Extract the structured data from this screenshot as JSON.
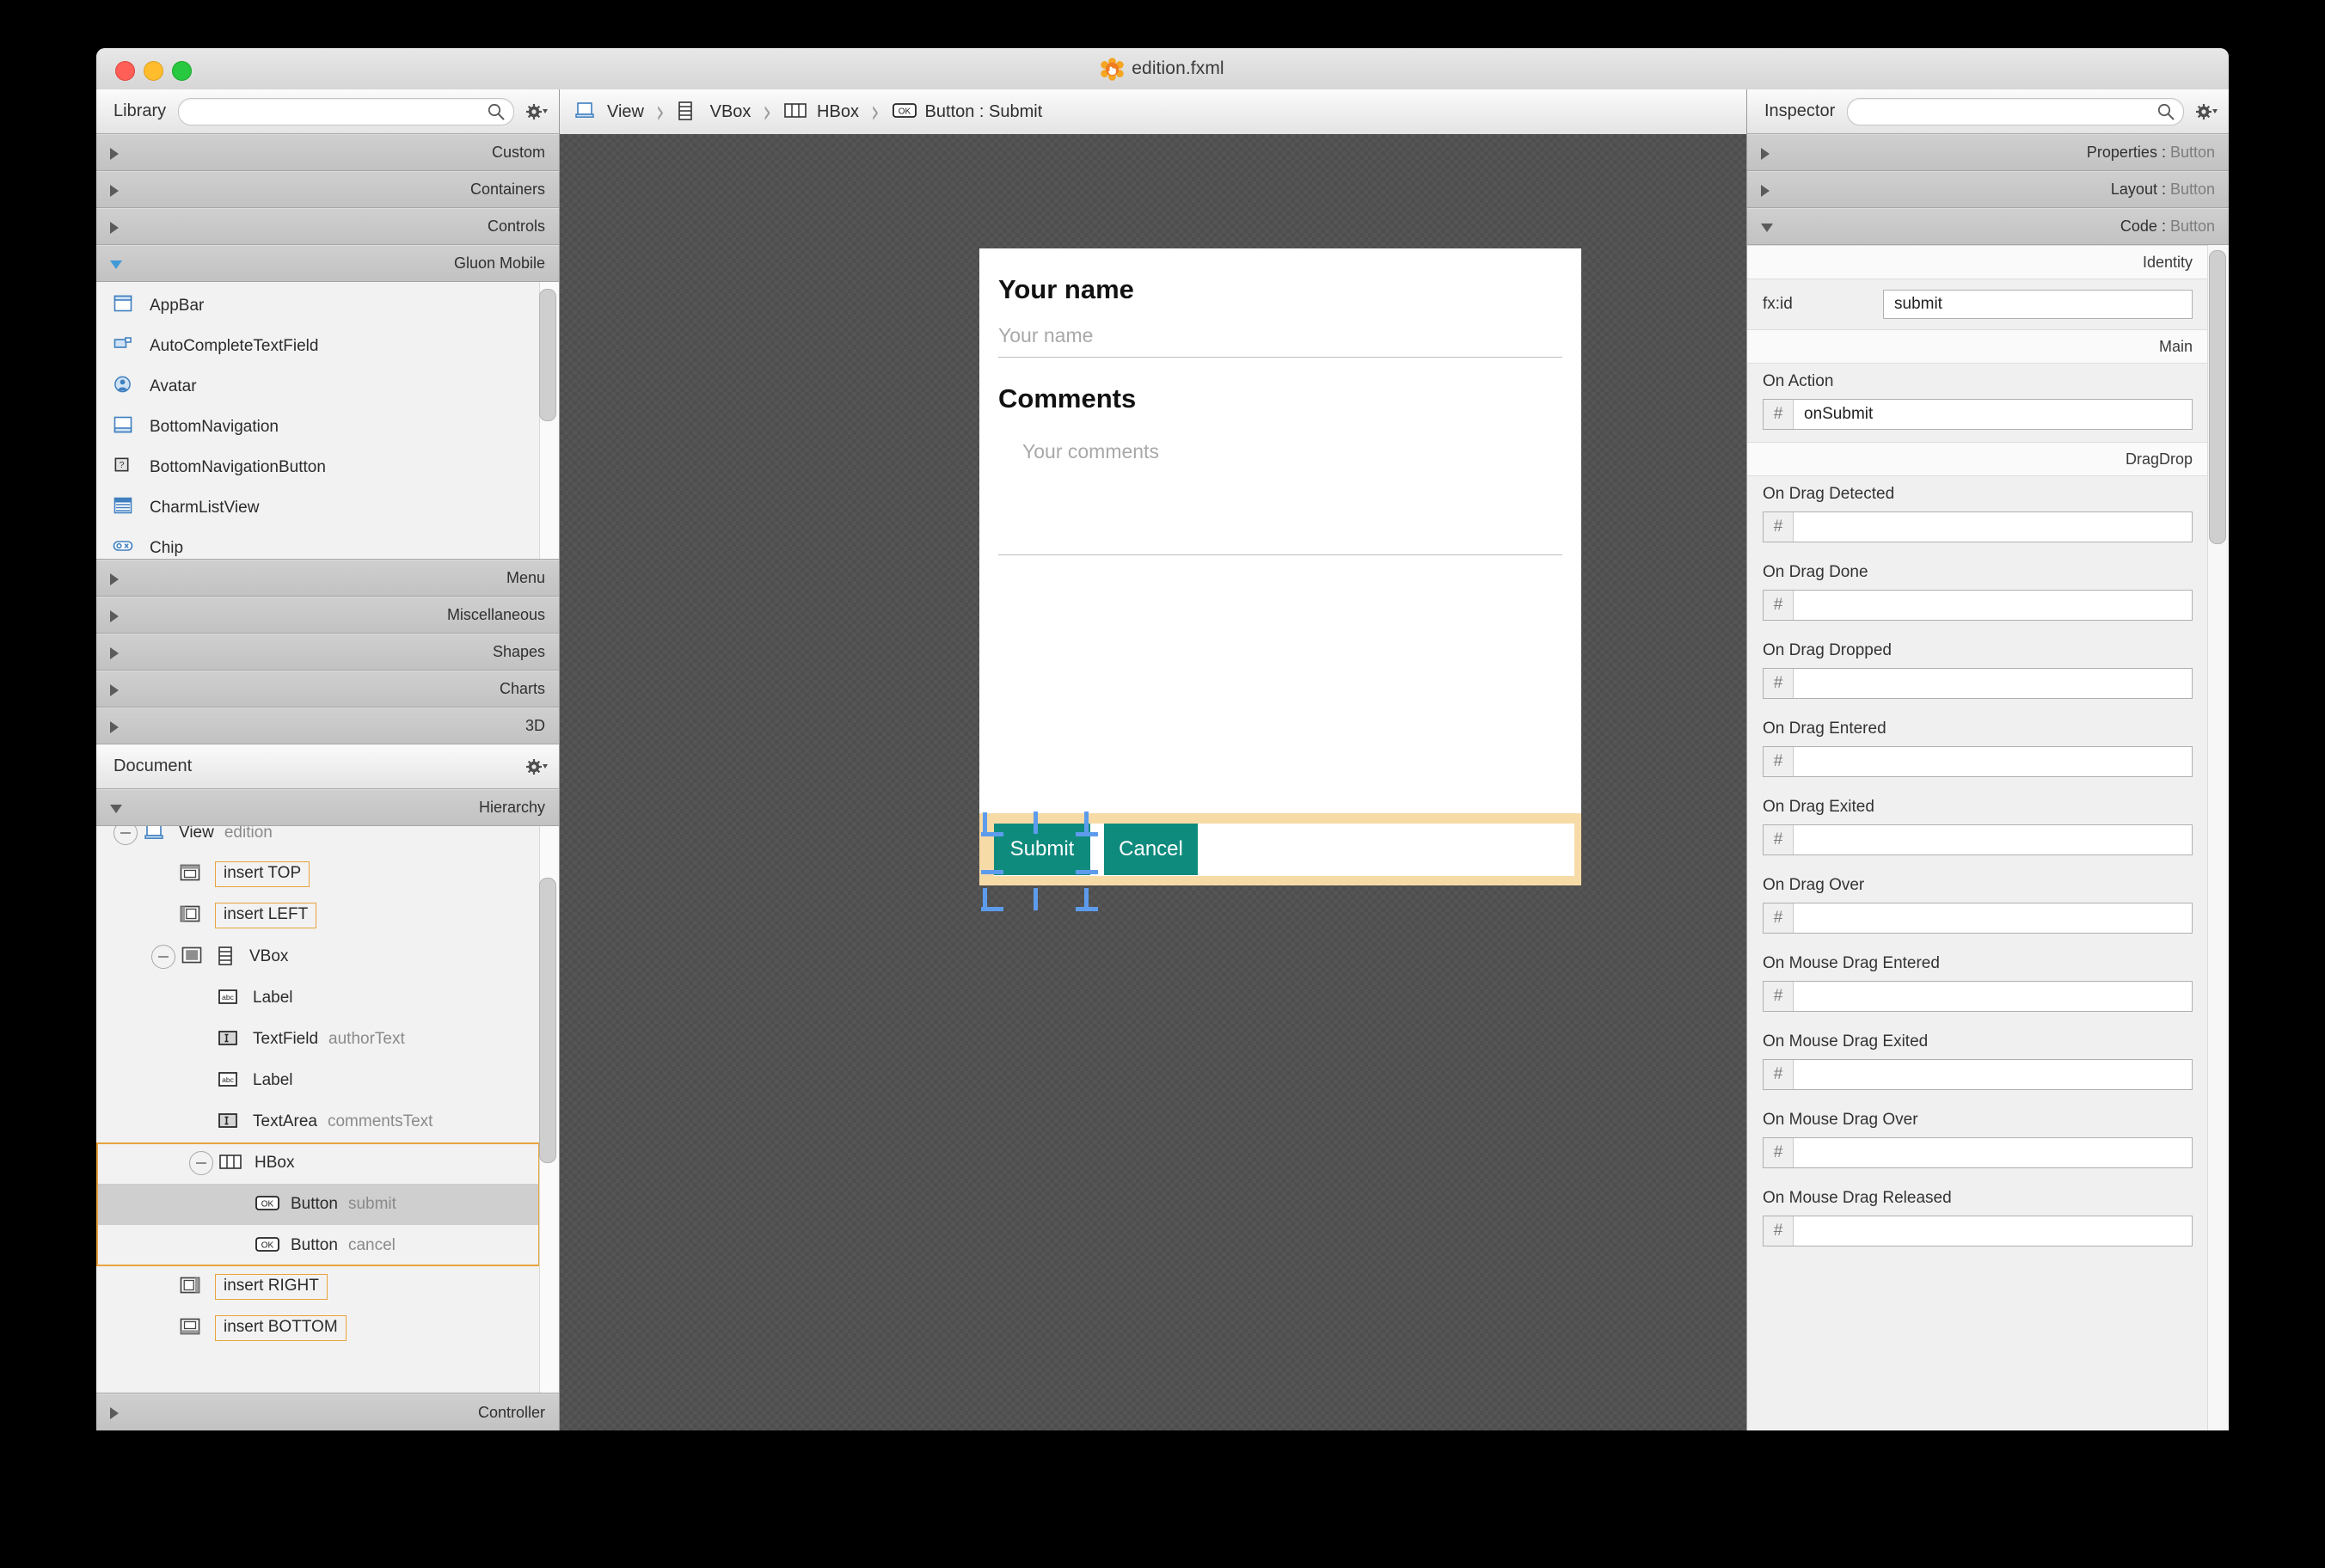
{
  "window": {
    "title": "edition.fxml",
    "app_icon": "scenebuilder-icon"
  },
  "library": {
    "panel_title": "Library",
    "search_placeholder": "",
    "search_value": "",
    "sections_top": [
      {
        "label": "Custom",
        "expanded": false
      },
      {
        "label": "Containers",
        "expanded": false
      },
      {
        "label": "Controls",
        "expanded": false
      },
      {
        "label": "Gluon Mobile",
        "expanded": true
      }
    ],
    "items": [
      {
        "label": "AppBar",
        "icon": "appbar-icon"
      },
      {
        "label": "AutoCompleteTextField",
        "icon": "autocomplete-textfield-icon"
      },
      {
        "label": "Avatar",
        "icon": "avatar-icon"
      },
      {
        "label": "BottomNavigation",
        "icon": "bottomnavigation-icon"
      },
      {
        "label": "BottomNavigationButton",
        "icon": "bottomnavigationbutton-icon"
      },
      {
        "label": "CharmListView",
        "icon": "charmlistview-icon"
      },
      {
        "label": "Chip",
        "icon": "chip-icon"
      }
    ],
    "sections_bottom": [
      {
        "label": "Menu",
        "expanded": false
      },
      {
        "label": "Miscellaneous",
        "expanded": false
      },
      {
        "label": "Shapes",
        "expanded": false
      },
      {
        "label": "Charts",
        "expanded": false
      },
      {
        "label": "3D",
        "expanded": false
      }
    ]
  },
  "document": {
    "panel_title": "Document",
    "hierarchy_label": "Hierarchy",
    "hierarchy_expanded": true,
    "controller_label": "Controller",
    "controller_expanded": false,
    "tree": [
      {
        "indent": 0,
        "expander": "minus",
        "icon": "view-icon",
        "name": "View",
        "fxid": "edition",
        "pill": false,
        "selected": false
      },
      {
        "indent": 1,
        "expander": "none",
        "icon": "insert-top-icon",
        "name": "insert TOP",
        "fxid": "",
        "pill": true,
        "selected": false
      },
      {
        "indent": 1,
        "expander": "none",
        "icon": "insert-left-icon",
        "name": "insert LEFT",
        "fxid": "",
        "pill": true,
        "selected": false
      },
      {
        "indent": 1,
        "expander": "minus",
        "icon": "center-icon",
        "icon2": "vbox-icon",
        "name": "VBox",
        "fxid": "",
        "pill": false,
        "selected": false
      },
      {
        "indent": 2,
        "expander": "none",
        "icon": "label-icon",
        "name": "Label",
        "fxid": "",
        "pill": false,
        "selected": false
      },
      {
        "indent": 2,
        "expander": "none",
        "icon": "textfield-icon",
        "name": "TextField",
        "fxid": "authorText",
        "pill": false,
        "selected": false
      },
      {
        "indent": 2,
        "expander": "none",
        "icon": "label-icon",
        "name": "Label",
        "fxid": "",
        "pill": false,
        "selected": false
      },
      {
        "indent": 2,
        "expander": "none",
        "icon": "textarea-icon",
        "name": "TextArea",
        "fxid": "commentsText",
        "pill": false,
        "selected": false
      },
      {
        "indent": 2,
        "expander": "minus",
        "icon": "hbox-icon",
        "name": "HBox",
        "fxid": "",
        "pill": false,
        "selected": false
      },
      {
        "indent": 3,
        "expander": "none",
        "icon": "button-icon",
        "name": "Button",
        "fxid": "submit",
        "pill": false,
        "selected": true
      },
      {
        "indent": 3,
        "expander": "none",
        "icon": "button-icon",
        "name": "Button",
        "fxid": "cancel",
        "pill": false,
        "selected": false
      },
      {
        "indent": 1,
        "expander": "none",
        "icon": "insert-right-icon",
        "name": "insert RIGHT",
        "fxid": "",
        "pill": true,
        "selected": false
      },
      {
        "indent": 1,
        "expander": "none",
        "icon": "insert-bottom-icon",
        "name": "insert BOTTOM",
        "fxid": "",
        "pill": true,
        "selected": false
      }
    ]
  },
  "breadcrumb": [
    {
      "label": "View",
      "icon": "view-icon"
    },
    {
      "label": "VBox",
      "icon": "vbox-icon"
    },
    {
      "label": "HBox",
      "icon": "hbox-icon"
    },
    {
      "label": "Button : Submit",
      "icon": "button-icon"
    }
  ],
  "canvas": {
    "name_heading": "Your name",
    "name_placeholder": "Your name",
    "comments_heading": "Comments",
    "comments_placeholder": "Your comments",
    "submit_label": "Submit",
    "cancel_label": "Cancel",
    "selection_color": "#5d9cec",
    "hbox_highlight_color": "#f7dba7",
    "button_color": "#0f8b7e"
  },
  "inspector": {
    "panel_title": "Inspector",
    "search_placeholder": "",
    "search_value": "",
    "sections": [
      {
        "label": "Properties",
        "target": "Button",
        "expanded": false
      },
      {
        "label": "Layout",
        "target": "Button",
        "expanded": false
      },
      {
        "label": "Code",
        "target": "Button",
        "expanded": true
      }
    ],
    "categories": {
      "identity": "Identity",
      "main": "Main",
      "dragdrop": "DragDrop"
    },
    "fxid_label": "fx:id",
    "fxid_value": "submit",
    "hash_prefix": "#",
    "events": [
      {
        "label": "On Action",
        "value": "onSubmit",
        "group": "main"
      },
      {
        "label": "On Drag Detected",
        "value": "",
        "group": "dragdrop"
      },
      {
        "label": "On Drag Done",
        "value": "",
        "group": "dragdrop"
      },
      {
        "label": "On Drag Dropped",
        "value": "",
        "group": "dragdrop"
      },
      {
        "label": "On Drag Entered",
        "value": "",
        "group": "dragdrop"
      },
      {
        "label": "On Drag Exited",
        "value": "",
        "group": "dragdrop"
      },
      {
        "label": "On Drag Over",
        "value": "",
        "group": "dragdrop"
      },
      {
        "label": "On Mouse Drag Entered",
        "value": "",
        "group": "dragdrop"
      },
      {
        "label": "On Mouse Drag Exited",
        "value": "",
        "group": "dragdrop"
      },
      {
        "label": "On Mouse Drag Over",
        "value": "",
        "group": "dragdrop"
      },
      {
        "label": "On Mouse Drag Released",
        "value": "",
        "group": "dragdrop"
      }
    ]
  }
}
